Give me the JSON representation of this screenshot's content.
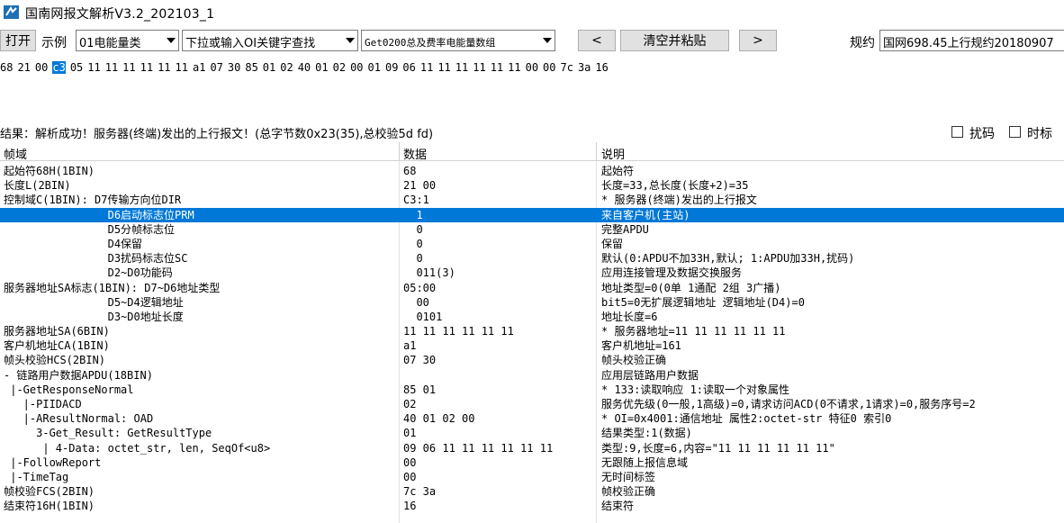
{
  "window": {
    "title": "国南网报文解析V3.2_202103_1"
  },
  "toolbar": {
    "open_label": "打开",
    "example_label": "示例",
    "category_select": "01电能量类",
    "search_select": "下拉或输入OI关键字查找",
    "item_select": "Get0200总及费率电能量数组",
    "prev_label": "<",
    "clear_paste_label": "清空并粘贴",
    "next_label": ">",
    "protocol_label": "规约",
    "protocol_value": "国网698.45上行规约20180907"
  },
  "hex": {
    "bytes": [
      "68",
      "21",
      "00",
      "c3",
      "05",
      "11",
      "11",
      "11",
      "11",
      "11",
      "11",
      "a1",
      "07",
      "30",
      "85",
      "01",
      "02",
      "40",
      "01",
      "02",
      "00",
      "01",
      "09",
      "06",
      "11",
      "11",
      "11",
      "11",
      "11",
      "11",
      "00",
      "00",
      "7c",
      "3a",
      "16"
    ],
    "selected_index": 3
  },
  "result": {
    "text": "结果：解析成功！服务器(终端)发出的上行报文！(总字节数0x23(35),总校验5d fd)",
    "checkbox_scramble": "扰码",
    "checkbox_timetag": "时标"
  },
  "grid": {
    "headers": {
      "field": "帧域",
      "data": "数据",
      "desc": "说明"
    },
    "rows": [
      {
        "field": "起始符68H(1BIN)",
        "data": "68",
        "desc": "起始符"
      },
      {
        "field": "长度L(2BIN)",
        "data": "21 00",
        "desc": "长度=33,总长度(长度+2)=35"
      },
      {
        "field": "控制域C(1BIN): D7传输方向位DIR",
        "data": "C3:1",
        "desc": "* 服务器(终端)发出的上行报文"
      },
      {
        "field": "                D6启动标志位PRM",
        "data": "  1",
        "desc": "来自客户机(主站)",
        "selected": true
      },
      {
        "field": "                D5分帧标志位",
        "data": "  0",
        "desc": "完整APDU"
      },
      {
        "field": "                D4保留",
        "data": "  0",
        "desc": "保留"
      },
      {
        "field": "                D3扰码标志位SC",
        "data": "  0",
        "desc": "默认(0:APDU不加33H,默认; 1:APDU加33H,扰码)"
      },
      {
        "field": "                D2~D0功能码",
        "data": "  011(3)",
        "desc": "应用连接管理及数据交换服务"
      },
      {
        "field": "服务器地址SA标志(1BIN): D7~D6地址类型",
        "data": "05:00",
        "desc": "地址类型=0(0单 1通配 2组 3广播)"
      },
      {
        "field": "                D5~D4逻辑地址",
        "data": "  00",
        "desc": "bit5=0无扩展逻辑地址 逻辑地址(D4)=0"
      },
      {
        "field": "                D3~D0地址长度",
        "data": "  0101",
        "desc": "地址长度=6"
      },
      {
        "field": "服务器地址SA(6BIN)",
        "data": "11 11 11 11 11 11",
        "desc": "* 服务器地址=11 11 11 11 11 11"
      },
      {
        "field": "客户机地址CA(1BIN)",
        "data": "a1",
        "desc": "客户机地址=161"
      },
      {
        "field": "帧头校验HCS(2BIN)",
        "data": "07 30",
        "desc": "帧头校验正确"
      },
      {
        "field": "- 链路用户数据APDU(18BIN)",
        "data": "",
        "desc": "应用层链路用户数据"
      },
      {
        "field": " |-GetResponseNormal",
        "data": "85 01",
        "desc": "* 133:读取响应 1:读取一个对象属性"
      },
      {
        "field": "   |-PIIDACD",
        "data": "02",
        "desc": "服务优先级(0一般,1高级)=0,请求访问ACD(0不请求,1请求)=0,服务序号=2"
      },
      {
        "field": "   |-AResultNormal: OAD",
        "data": "40 01 02 00",
        "desc": "* OI=0x4001:通信地址 属性2:octet-str 特征0 索引0"
      },
      {
        "field": "     3-Get_Result: GetResultType",
        "data": "01",
        "desc": "结果类型:1(数据)"
      },
      {
        "field": "      | 4-Data: octet_str, len, SeqOf<u8>",
        "data": "09 06 11 11 11 11 11 11",
        "desc": "类型:9,长度=6,内容=\"11 11 11 11 11 11\""
      },
      {
        "field": " |-FollowReport",
        "data": "00",
        "desc": "无跟随上报信息域"
      },
      {
        "field": " |-TimeTag",
        "data": "00",
        "desc": "无时间标签"
      },
      {
        "field": "帧校验FCS(2BIN)",
        "data": "7c 3a",
        "desc": "帧校验正确"
      },
      {
        "field": "结束符16H(1BIN)",
        "data": "16",
        "desc": "结束符"
      }
    ]
  }
}
